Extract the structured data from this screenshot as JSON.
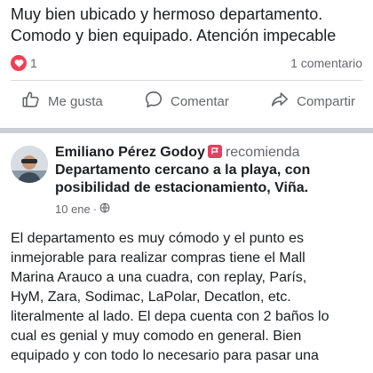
{
  "post": {
    "text_lines": [
      "Muy bien ubicado y hermoso departamento.",
      "Comodo y bien equipado. Atención impecable"
    ],
    "reaction_count": "1",
    "comment_count": "1 comentario"
  },
  "actions": {
    "like": "Me gusta",
    "comment": "Comentar",
    "share": "Compartir"
  },
  "review": {
    "author": "Emiliano Pérez Godoy",
    "recommends": "recomienda",
    "title_lines": [
      "Departamento cercano a la playa, con",
      "posibilidad de estacionamiento, Viña."
    ],
    "date": "10 ene",
    "separator": "·",
    "body_lines": [
      "El departamento es muy cómodo y el punto es",
      "inmejorable para realizar compras tiene el Mall",
      "Marina Arauco a una cuadra, con replay, París,",
      "HyM, Zara, Sodimac, LaPolar, Decatlon, etc.",
      "literalmente al lado. El depa cuenta con 2 baños lo",
      "cual es genial y muy comodo en general. Bien",
      "equipado y con todo lo necesario para pasar una"
    ]
  },
  "icons": {
    "reaction": "heart-icon",
    "like": "thumbs-up-icon",
    "comment": "comment-bubble-icon",
    "share": "share-arrow-icon",
    "recommend": "recommend-flag-icon",
    "privacy": "globe-icon"
  },
  "colors": {
    "heart": "#f33e58",
    "secondary_text": "#65676b",
    "recommend_flag": "#e4405f"
  }
}
